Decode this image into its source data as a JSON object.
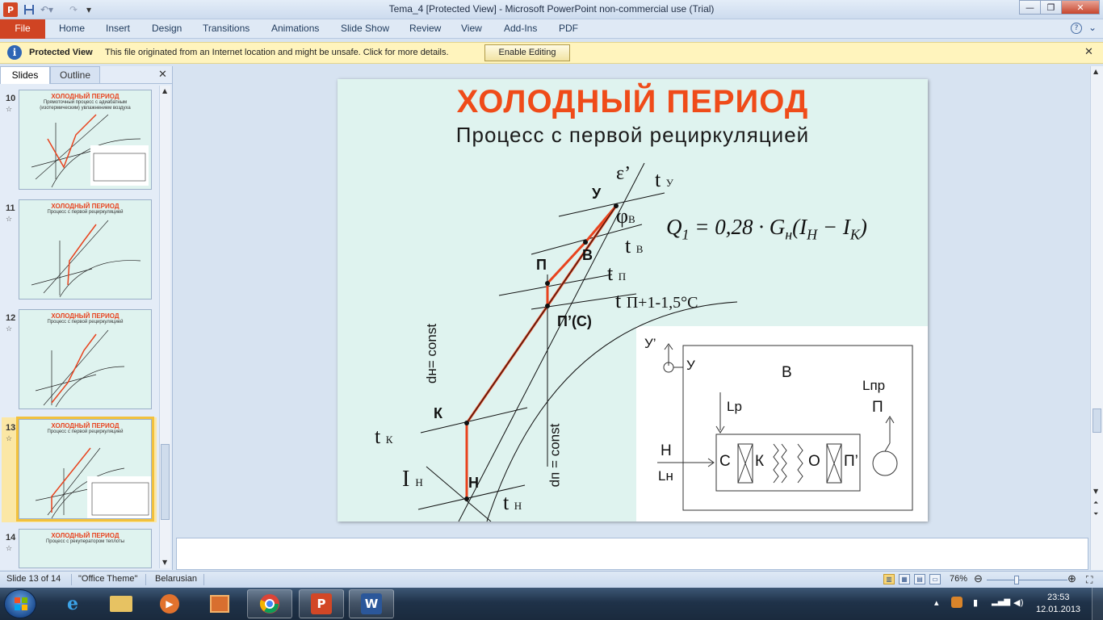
{
  "window": {
    "title": "Tema_4 [Protected View]  -  Microsoft PowerPoint non-commercial use (Trial)",
    "app_icon": "P",
    "controls": {
      "minimize": "—",
      "maximize": "❐",
      "close": "✕"
    }
  },
  "ribbon": {
    "tabs": [
      "File",
      "Home",
      "Insert",
      "Design",
      "Transitions",
      "Animations",
      "Slide Show",
      "Review",
      "View",
      "Add-Ins",
      "PDF"
    ],
    "help": "?"
  },
  "protected_view": {
    "title": "Protected View",
    "message": "This file originated from an Internet location and might be unsafe. Click for more details.",
    "button": "Enable Editing"
  },
  "panel": {
    "tabs": {
      "slides": "Slides",
      "outline": "Outline"
    },
    "thumbnails": [
      {
        "number": "10",
        "title": "ХОЛОДНЫЙ ПЕРИОД",
        "subtitle": "Прямоточный процесс с адиабатным (изотермическим) увлажнением воздуха",
        "selected": false
      },
      {
        "number": "11",
        "title": "ХОЛОДНЫЙ ПЕРИОД",
        "subtitle": "Процесс с первой рециркуляцией",
        "selected": false
      },
      {
        "number": "12",
        "title": "ХОЛОДНЫЙ ПЕРИОД",
        "subtitle": "Процесс с первой рециркуляцией",
        "selected": false
      },
      {
        "number": "13",
        "title": "ХОЛОДНЫЙ ПЕРИОД",
        "subtitle": "Процесс с первой рециркуляцией",
        "selected": true
      },
      {
        "number": "14",
        "title": "ХОЛОДНЫЙ ПЕРИОД",
        "subtitle": "Процесс с рекуператором теплоты",
        "selected": false
      }
    ]
  },
  "slide": {
    "title": "ХОЛОДНЫЙ ПЕРИОД",
    "subtitle": "Процесс  с первой рециркуляцией",
    "formula": {
      "lhs": "Q",
      "lhs_sub": "1",
      "eq": " = 0,28 · G",
      "g_sub": "н",
      "paren_open": "(I",
      "i1_sub": "Н",
      "minus": " − I",
      "i2_sub": "К",
      "paren_close": ")"
    },
    "diagram": {
      "eps": "ε’",
      "t_u": "t",
      "t_u_sub": "У",
      "point_u": "У",
      "phi": "φ",
      "phi_sub": "В",
      "t_v": "t",
      "t_v_sub": "В",
      "point_v": "В",
      "point_p": "П",
      "t_p": "t",
      "t_p_sub": "П",
      "t_p2": "t",
      "t_p2_sub": "П+1-1,5°С",
      "point_pc": "П’(С)",
      "dh_const": "dн= const",
      "dp_const": "dп = const",
      "point_k": "К",
      "t_k": "t",
      "t_k_sub": "К",
      "i_n": "I",
      "i_n_sub": "Н",
      "point_n": "Н",
      "t_n": "t",
      "t_n_sub": "Н"
    },
    "scheme": {
      "u_prime": "У’",
      "u": "У",
      "b": "В",
      "lr": "Lр",
      "lpr": "Lпр",
      "p": "П",
      "n": "Н",
      "ln": "Lн",
      "sections": [
        "С",
        "К",
        "О",
        "П’"
      ]
    }
  },
  "status": {
    "slide_info": "Slide 13 of 14",
    "theme": "\"Office Theme\"",
    "language": "Belarusian",
    "zoom": "76%"
  },
  "taskbar": {
    "time": "23:53",
    "date": "12.01.2013",
    "apps": [
      "internet-explorer",
      "explorer",
      "media-player",
      "control-panel",
      "chrome",
      "powerpoint",
      "word"
    ]
  }
}
